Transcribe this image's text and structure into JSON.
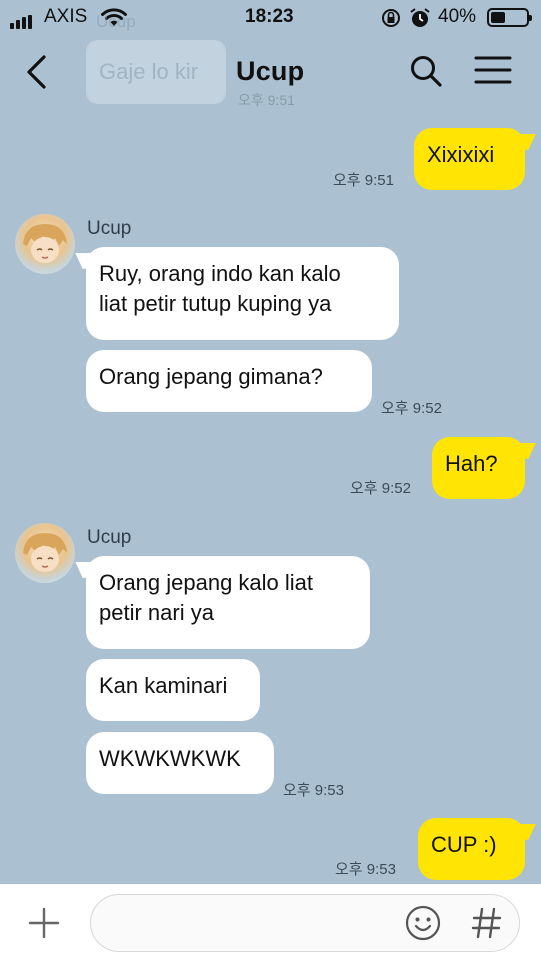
{
  "status": {
    "carrier": "AXIS",
    "time": "18:23",
    "battery": "40%"
  },
  "header": {
    "title": "Ucup",
    "ghost_preview": "Gaje lo kir",
    "ghost_sender": "Ucup",
    "ghost_time": "오후 9:51"
  },
  "messages": [
    {
      "side": "out",
      "text": "Xixixixi",
      "time": "오후 9:51"
    },
    {
      "side": "in",
      "sender": "Ucup",
      "text1": "Ruy, orang indo kan kalo",
      "text2": "liat petir tutup kuping ya"
    },
    {
      "side": "in",
      "text": "Orang jepang gimana?",
      "time": "오후 9:52"
    },
    {
      "side": "out",
      "text": "Hah?",
      "time": "오후 9:52"
    },
    {
      "side": "in",
      "sender": "Ucup",
      "text1": "Orang jepang kalo liat",
      "text2": "petir nari ya"
    },
    {
      "side": "in",
      "text": "Kan kaminari"
    },
    {
      "side": "in",
      "text": "WKWKWKWK",
      "time": "오후 9:53"
    },
    {
      "side": "out",
      "text": "CUP :)",
      "time": "오후 9:53"
    }
  ],
  "composer": {
    "plus_icon": "plus-icon",
    "emoji_icon": "emoji-icon",
    "hash_icon": "hashtag-icon"
  }
}
